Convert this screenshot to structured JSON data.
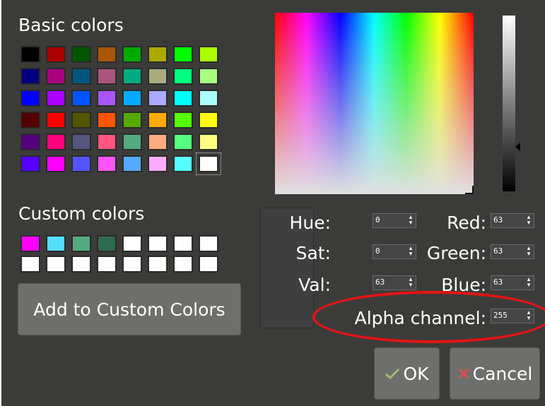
{
  "basic_colors_label": "Basic colors",
  "basic_colors": [
    [
      "#000000",
      "#aa0000",
      "#005500",
      "#aa5500",
      "#00aa00",
      "#aaaa00",
      "#00ff00",
      "#aaff00"
    ],
    [
      "#00007f",
      "#aa007f",
      "#00557f",
      "#aa557f",
      "#00aa7f",
      "#aaaa7f",
      "#00ff7f",
      "#aaff7f"
    ],
    [
      "#0000ff",
      "#aa00ff",
      "#0055ff",
      "#aa55ff",
      "#00aaff",
      "#aaaaff",
      "#00ffff",
      "#aaffff"
    ],
    [
      "#550000",
      "#ff0000",
      "#555500",
      "#ff5500",
      "#55aa00",
      "#ffaa00",
      "#55ff00",
      "#ffff00"
    ],
    [
      "#55007f",
      "#ff007f",
      "#55557f",
      "#ff557f",
      "#55aa7f",
      "#ffaa7f",
      "#55ff7f",
      "#ffff7f"
    ],
    [
      "#5500ff",
      "#ff00ff",
      "#5555ff",
      "#ff55ff",
      "#55aaff",
      "#ffaaff",
      "#55ffff",
      "#ffffff"
    ]
  ],
  "custom_colors_label": "Custom colors",
  "custom_colors": [
    [
      "#ff00ff",
      "#55ddff",
      "#55aa7f",
      "#2e6a4e",
      "#ffffff",
      "#ffffff",
      "#ffffff",
      "#ffffff"
    ],
    [
      "#ffffff",
      "#ffffff",
      "#ffffff",
      "#ffffff",
      "#ffffff",
      "#ffffff",
      "#ffffff",
      "#ffffff"
    ]
  ],
  "add_custom_label": "Add to Custom Colors",
  "fields": {
    "hue": {
      "label": "Hue:",
      "value": "0"
    },
    "sat": {
      "label": "Sat:",
      "value": "0"
    },
    "val": {
      "label": "Val:",
      "value": "63"
    },
    "red": {
      "label": "Red:",
      "value": "63"
    },
    "green": {
      "label": "Green:",
      "value": "63"
    },
    "blue": {
      "label": "Blue:",
      "value": "63"
    },
    "alpha": {
      "label": "Alpha channel:",
      "value": "255"
    }
  },
  "ok_label": "OK",
  "cancel_label": "Cancel",
  "current_color": "#3f3f3f",
  "highlight_color": "#e51414"
}
